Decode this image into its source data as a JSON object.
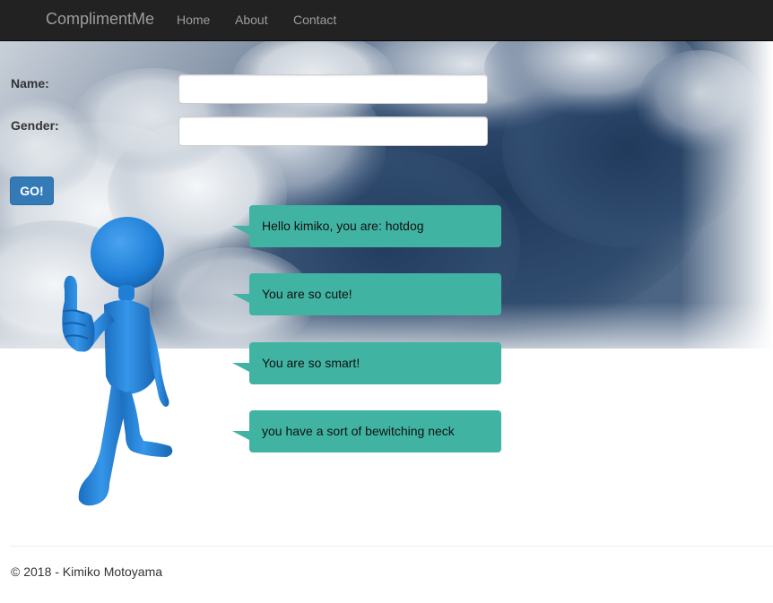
{
  "navbar": {
    "brand": "ComplimentMe",
    "links": [
      "Home",
      "About",
      "Contact"
    ]
  },
  "form": {
    "name_label": "Name:",
    "name_value": "",
    "gender_label": "Gender:",
    "gender_value": "",
    "submit_label": "GO!"
  },
  "compliments": [
    "Hello kimiko, you are: hotdog",
    "You are so cute!",
    "You are so smart!",
    "you have a sort of bewitching neck"
  ],
  "footer": {
    "text": "© 2018 - Kimiko Motoyama"
  },
  "colors": {
    "navbar_bg": "#222222",
    "nav_text": "#9d9d9d",
    "button_bg": "#337ab7",
    "bubble_bg": "#40b3a2",
    "figure": "#1f7fd6"
  },
  "icons": {
    "hero": "cloud-image",
    "figure": "thumbs-up-stick-figure"
  }
}
